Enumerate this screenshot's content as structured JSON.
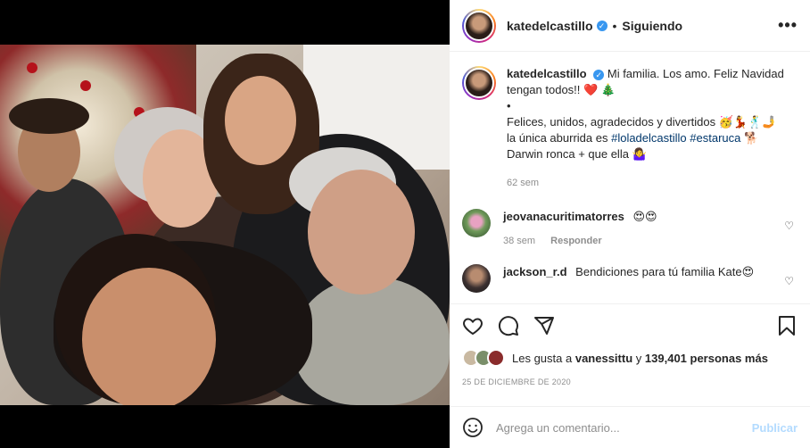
{
  "post": {
    "username": "katedelcastillo",
    "follow_status": "Siguiendo",
    "more_icon": "more-horizontal-icon",
    "caption_lines": [
      "Mi familia. Los amo. Feliz Navidad tengan todos!! ❤️ 🎄",
      "•",
      "Felices, unidos, agradecidos y divertidos 🥳💃🕺🤳",
      "la única aburrida es",
      "#loladelcastillo",
      "#estaruca",
      "🐕",
      "Darwin ronca + que ella 🤷‍♀️"
    ],
    "caption_age": "62 sem"
  },
  "comments": [
    {
      "username": "jeovanacuritimatorres",
      "text": "😍😍",
      "age": "38 sem",
      "reply_label": "Responder"
    },
    {
      "username": "jackson_r.d",
      "text": "Bendiciones para tú familia Kate😍"
    }
  ],
  "likes": {
    "prefix": "Les gusta a",
    "user": "vanessittu",
    "connector": "y",
    "count_text": "139,401 personas más"
  },
  "date": "25 DE DICIEMBRE DE 2020",
  "composer": {
    "placeholder": "Agrega un comentario...",
    "publish_label": "Publicar"
  },
  "colors": {
    "accent": "#0095f6",
    "link": "#00376b",
    "muted": "#8e8e8e",
    "heart": "#ed4956"
  }
}
